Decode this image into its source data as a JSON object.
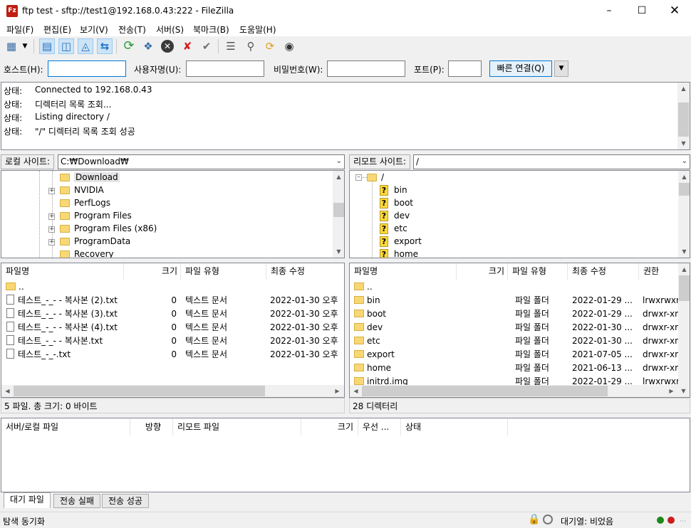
{
  "window": {
    "title": "ftp test - sftp://test1@192.168.0.43:222 - FileZilla",
    "icon_text": "Fz"
  },
  "menu": [
    "파일(F)",
    "편집(E)",
    "보기(V)",
    "전송(T)",
    "서버(S)",
    "북마크(B)",
    "도움말(H)"
  ],
  "toolbar_icons": [
    "site-manager-icon",
    "dropdown-arrow-icon",
    "toggle-log-icon",
    "toggle-local-tree-icon",
    "toggle-remote-tree-icon",
    "toggle-queue-icon",
    "refresh-icon",
    "process-queue-icon",
    "cancel-icon",
    "disconnect-icon",
    "reconnect-icon",
    "filter-icon",
    "compare-icon",
    "sync-browse-icon",
    "search-icon"
  ],
  "quickconnect": {
    "host_label": "호스트(H):",
    "host_value": "",
    "user_label": "사용자명(U):",
    "user_value": "",
    "pass_label": "비밀번호(W):",
    "pass_value": "",
    "port_label": "포트(P):",
    "port_value": "",
    "connect_label": "빠른 연결(Q)"
  },
  "log": [
    {
      "label": "상태:",
      "text": "Connected to 192.168.0.43"
    },
    {
      "label": "상태:",
      "text": "디렉터리 목록 조회..."
    },
    {
      "label": "상태:",
      "text": "Listing directory /"
    },
    {
      "label": "상태:",
      "text": "\"/\" 디렉터리 목록 조회 성공"
    }
  ],
  "local": {
    "site_label": "로컬 사이트:",
    "path": "C:₩Download₩",
    "tree": [
      {
        "name": "Download",
        "expander": "",
        "selected": true
      },
      {
        "name": "NVIDIA",
        "expander": "+"
      },
      {
        "name": "PerfLogs",
        "expander": ""
      },
      {
        "name": "Program Files",
        "expander": "+"
      },
      {
        "name": "Program Files (x86)",
        "expander": "+"
      },
      {
        "name": "ProgramData",
        "expander": "+"
      },
      {
        "name": "Recovery",
        "expander": ""
      }
    ],
    "columns": [
      "파일명",
      "크기",
      "파일 유형",
      "최종 수정"
    ],
    "files": [
      {
        "name": "..",
        "size": "",
        "type": "",
        "modified": "",
        "icon": "folder"
      },
      {
        "name": "테스트_-_- - 복사본 (2).txt",
        "size": "0",
        "type": "텍스트 문서",
        "modified": "2022-01-30 오후 ...",
        "icon": "text"
      },
      {
        "name": "테스트_-_- - 복사본 (3).txt",
        "size": "0",
        "type": "텍스트 문서",
        "modified": "2022-01-30 오후 ...",
        "icon": "text"
      },
      {
        "name": "테스트_-_- - 복사본 (4).txt",
        "size": "0",
        "type": "텍스트 문서",
        "modified": "2022-01-30 오후 ...",
        "icon": "text"
      },
      {
        "name": "테스트_-_- - 복사본.txt",
        "size": "0",
        "type": "텍스트 문서",
        "modified": "2022-01-30 오후 ...",
        "icon": "text"
      },
      {
        "name": "테스트_-_-.txt",
        "size": "0",
        "type": "텍스트 문서",
        "modified": "2022-01-30 오후 ...",
        "icon": "text"
      }
    ],
    "status": "5 파일. 총 크기: 0 바이트"
  },
  "remote": {
    "site_label": "리모트 사이트:",
    "path": "/",
    "tree_root": "/",
    "tree": [
      "bin",
      "boot",
      "dev",
      "etc",
      "export",
      "home"
    ],
    "columns": [
      "파일명",
      "크기",
      "파일 유형",
      "최종 수정",
      "권한"
    ],
    "files": [
      {
        "name": "..",
        "type": "",
        "modified": "",
        "perm": "",
        "icon": "folder"
      },
      {
        "name": "bin",
        "type": "파일 폴더",
        "modified": "2022-01-29 ...",
        "perm": "lrwxrwxrw",
        "icon": "link"
      },
      {
        "name": "boot",
        "type": "파일 폴더",
        "modified": "2022-01-29 ...",
        "perm": "drwxr-xr-",
        "icon": "folder"
      },
      {
        "name": "dev",
        "type": "파일 폴더",
        "modified": "2022-01-30 ...",
        "perm": "drwxr-xr-",
        "icon": "folder"
      },
      {
        "name": "etc",
        "type": "파일 폴더",
        "modified": "2022-01-30 ...",
        "perm": "drwxr-xr-",
        "icon": "folder"
      },
      {
        "name": "export",
        "type": "파일 폴더",
        "modified": "2021-07-05 ...",
        "perm": "drwxr-xr-",
        "icon": "folder"
      },
      {
        "name": "home",
        "type": "파일 폴더",
        "modified": "2021-06-13 ...",
        "perm": "drwxr-xr-",
        "icon": "folder"
      },
      {
        "name": "initrd.img",
        "type": "파일 폴더",
        "modified": "2022-01-29 ...",
        "perm": "lrwxrwxrw",
        "icon": "link"
      }
    ],
    "status": "28 디렉터리"
  },
  "queue": {
    "columns": [
      "서버/로컬 파일",
      "방향",
      "리모트 파일",
      "크기",
      "우선 ...",
      "상태"
    ],
    "tabs": [
      "대기 파일",
      "전송 실패",
      "전송 성공"
    ]
  },
  "statusbar": {
    "left": "탐색 동기화",
    "queue": "대기열: 비었음"
  }
}
